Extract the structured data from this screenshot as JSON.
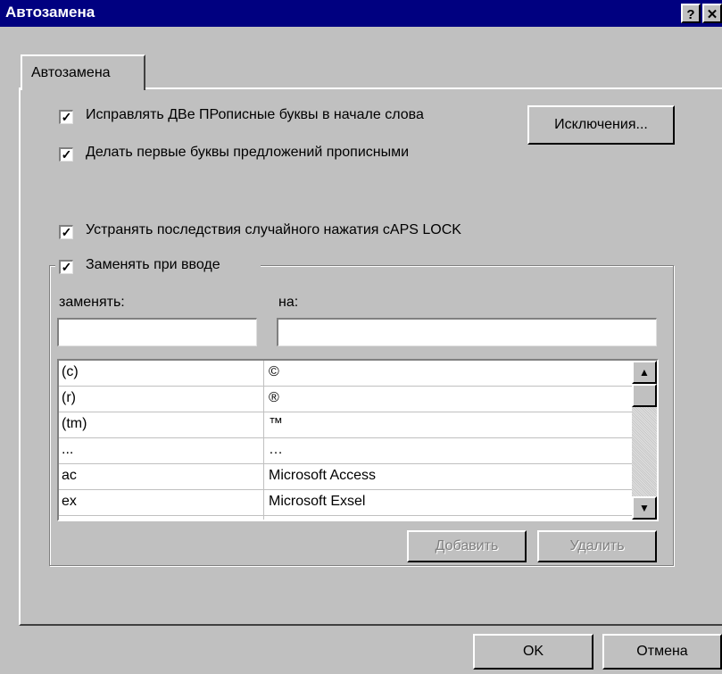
{
  "window": {
    "title": "Автозамена",
    "help_label": "?",
    "close_label": "✕"
  },
  "tabs": [
    {
      "label": "Автозамена",
      "active": true
    }
  ],
  "options": {
    "two_caps": {
      "label": "Исправлять ДВе ПРописные буквы в начале слова",
      "checked": true
    },
    "first_letter": {
      "label": "Делать первые буквы предложений прописными",
      "checked": true
    },
    "caps_lock": {
      "label": "Устранять последствия случайного нажатия cAPS LOCK",
      "checked": true
    },
    "replace_on_type": {
      "label": "Заменять при вводе",
      "checked": true
    }
  },
  "exceptions_button": "Исключения...",
  "replace_section": {
    "replace_label": "заменять:",
    "with_label": "на:",
    "replace_value": "",
    "with_value": "",
    "entries": [
      {
        "from": "(c)",
        "to": "©"
      },
      {
        "from": "(r)",
        "to": "®"
      },
      {
        "from": "(tm)",
        "to": "™"
      },
      {
        "from": "...",
        "to": "…"
      },
      {
        "from": "ac",
        "to": "Microsoft Access"
      },
      {
        "from": "ex",
        "to": "Microsoft Exsel"
      }
    ],
    "add_button": "Добавить",
    "delete_button": "Удалить"
  },
  "footer": {
    "ok_button": "OK",
    "cancel_button": "Отмена"
  },
  "colors": {
    "titlebar": "#000080",
    "face": "#c0c0c0"
  }
}
